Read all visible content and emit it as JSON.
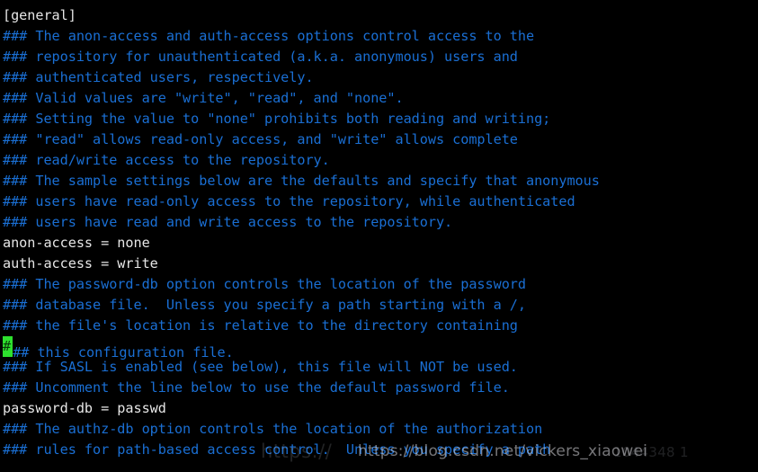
{
  "terminal": {
    "background_color": "#000000",
    "comment_color": "#1a6fd4",
    "setting_color": "#e6e6e6",
    "cursor_color": "#2ee02e",
    "file_section": "[general]",
    "lines": [
      {
        "text": "[general]",
        "type": "setting"
      },
      {
        "text": "### The anon-access and auth-access options control access to the",
        "type": "comment"
      },
      {
        "text": "### repository for unauthenticated (a.k.a. anonymous) users and",
        "type": "comment"
      },
      {
        "text": "### authenticated users, respectively.",
        "type": "comment"
      },
      {
        "text": "### Valid values are \"write\", \"read\", and \"none\".",
        "type": "comment"
      },
      {
        "text": "### Setting the value to \"none\" prohibits both reading and writing;",
        "type": "comment"
      },
      {
        "text": "### \"read\" allows read-only access, and \"write\" allows complete",
        "type": "comment"
      },
      {
        "text": "### read/write access to the repository.",
        "type": "comment"
      },
      {
        "text": "### The sample settings below are the defaults and specify that anonymous",
        "type": "comment"
      },
      {
        "text": "### users have read-only access to the repository, while authenticated",
        "type": "comment"
      },
      {
        "text": "### users have read and write access to the repository.",
        "type": "comment"
      },
      {
        "text": "anon-access = none",
        "type": "setting"
      },
      {
        "text": "auth-access = write",
        "type": "setting"
      },
      {
        "text": "### The password-db option controls the location of the password",
        "type": "comment"
      },
      {
        "text": "### database file.  Unless you specify a path starting with a /,",
        "type": "comment"
      },
      {
        "text": "### the file's location is relative to the directory containing",
        "type": "comment"
      },
      {
        "text": "### this configuration file.",
        "type": "comment",
        "cursor_col": 0
      },
      {
        "text": "### If SASL is enabled (see below), this file will NOT be used.",
        "type": "comment"
      },
      {
        "text": "### Uncomment the line below to use the default password file.",
        "type": "comment"
      },
      {
        "text": "password-db = passwd",
        "type": "setting"
      },
      {
        "text": "### The authz-db option controls the location of the authorization",
        "type": "comment"
      },
      {
        "text": "### rules for path-based access control.  Unless you specify a path",
        "type": "comment"
      }
    ]
  },
  "watermark": {
    "main": "https://blog.csdn.net/vickers_xiaowei",
    "faint": "https://",
    "faint_tail": "1044348 1"
  }
}
